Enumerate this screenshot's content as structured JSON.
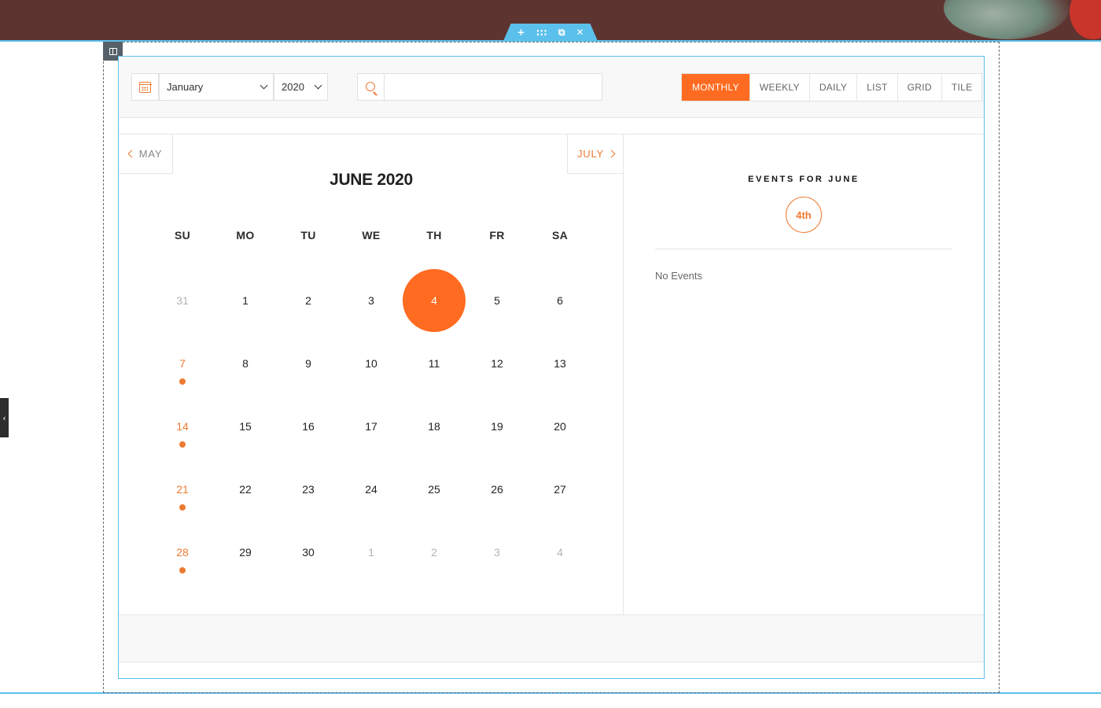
{
  "editor": {
    "edit_bar_icons": [
      "plus-icon",
      "drag-handle-icon",
      "duplicate-icon",
      "close-icon"
    ],
    "glyphs": {
      "plus": "+",
      "drag": ":::",
      "duplicate": "⧉",
      "close": "✕",
      "side_toggle": "‹"
    },
    "accent_color": "#5bc0eb"
  },
  "filters": {
    "month_value": "January",
    "year_value": "2020",
    "search_placeholder": ""
  },
  "view_tabs": [
    {
      "label": "MONTHLY",
      "active": true
    },
    {
      "label": "WEEKLY",
      "active": false
    },
    {
      "label": "DAILY",
      "active": false
    },
    {
      "label": "LIST",
      "active": false
    },
    {
      "label": "GRID",
      "active": false
    },
    {
      "label": "TILE",
      "active": false
    }
  ],
  "navigation": {
    "prev_label": "MAY",
    "next_label": "JULY"
  },
  "calendar": {
    "title": "JUNE 2020",
    "weekdays": [
      "SU",
      "MO",
      "TU",
      "WE",
      "TH",
      "FR",
      "SA"
    ],
    "days": [
      {
        "d": "31",
        "muted": true
      },
      {
        "d": "1"
      },
      {
        "d": "2"
      },
      {
        "d": "3"
      },
      {
        "d": "4",
        "today": true
      },
      {
        "d": "5"
      },
      {
        "d": "6"
      },
      {
        "d": "7",
        "event": true
      },
      {
        "d": "8"
      },
      {
        "d": "9"
      },
      {
        "d": "10"
      },
      {
        "d": "11"
      },
      {
        "d": "12"
      },
      {
        "d": "13"
      },
      {
        "d": "14",
        "event": true
      },
      {
        "d": "15"
      },
      {
        "d": "16"
      },
      {
        "d": "17"
      },
      {
        "d": "18"
      },
      {
        "d": "19"
      },
      {
        "d": "20"
      },
      {
        "d": "21",
        "event": true
      },
      {
        "d": "22"
      },
      {
        "d": "23"
      },
      {
        "d": "24"
      },
      {
        "d": "25"
      },
      {
        "d": "26"
      },
      {
        "d": "27"
      },
      {
        "d": "28",
        "event": true
      },
      {
        "d": "29"
      },
      {
        "d": "30"
      },
      {
        "d": "1",
        "muted": true
      },
      {
        "d": "2",
        "muted": true
      },
      {
        "d": "3",
        "muted": true
      },
      {
        "d": "4",
        "muted": true
      }
    ],
    "accent_color": "#ff6b20"
  },
  "events_panel": {
    "title": "EVENTS FOR JUNE",
    "selected_day": "4th",
    "empty_text": "No Events"
  }
}
